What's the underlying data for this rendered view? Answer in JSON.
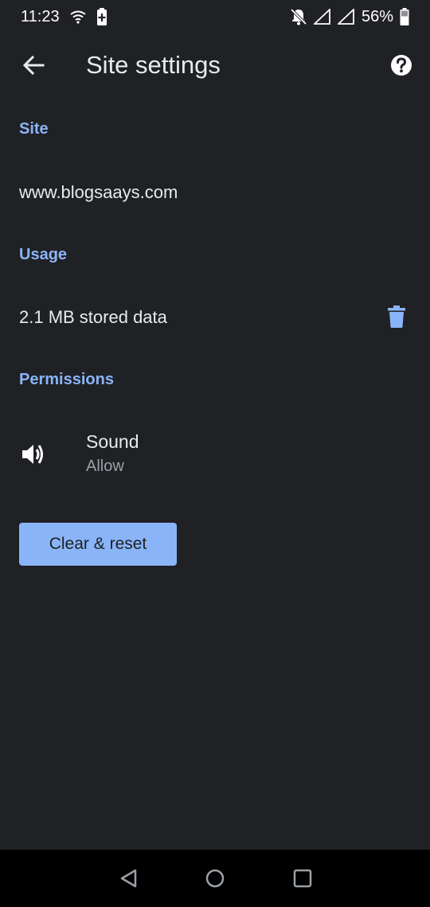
{
  "status_bar": {
    "time": "11:23",
    "battery_percent": "56%",
    "icons": [
      "wifi-icon",
      "battery-saver-icon",
      "notifications-off-icon",
      "signal-icon",
      "signal-icon",
      "battery-icon"
    ]
  },
  "app_bar": {
    "title": "Site settings",
    "back_icon": "arrow-back-icon",
    "help_icon": "help-icon"
  },
  "site": {
    "header": "Site",
    "url": "www.blogsaays.com"
  },
  "usage": {
    "header": "Usage",
    "stored_data": "2.1 MB stored data",
    "delete_icon": "trash-icon"
  },
  "permissions": {
    "header": "Permissions",
    "items": [
      {
        "icon": "volume-icon",
        "label": "Sound",
        "value": "Allow"
      }
    ]
  },
  "actions": {
    "clear_reset_label": "Clear & reset"
  },
  "nav_bar": {
    "icons": [
      "back-triangle-icon",
      "home-circle-icon",
      "recents-square-icon"
    ]
  },
  "colors": {
    "background": "#202124",
    "accent": "#8ab4f8",
    "text_primary": "#e8eaed",
    "text_secondary": "#9aa0a6",
    "nav_background": "#000000"
  }
}
